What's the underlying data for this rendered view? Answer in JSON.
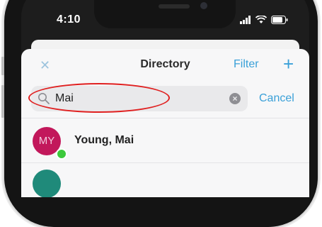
{
  "status_bar": {
    "time": "4:10"
  },
  "header": {
    "close_icon": "close-icon",
    "title": "Directory",
    "filter_label": "Filter",
    "add_label": "+"
  },
  "search": {
    "value": "Mai",
    "cancel_label": "Cancel"
  },
  "results": [
    {
      "initials": "MY",
      "name": "Young, Mai",
      "avatar_color": "#c2185b",
      "presence": "online",
      "presence_color": "#3cc93c"
    }
  ],
  "colors": {
    "accent": "#3aa0d8",
    "annotation": "#e02020"
  }
}
